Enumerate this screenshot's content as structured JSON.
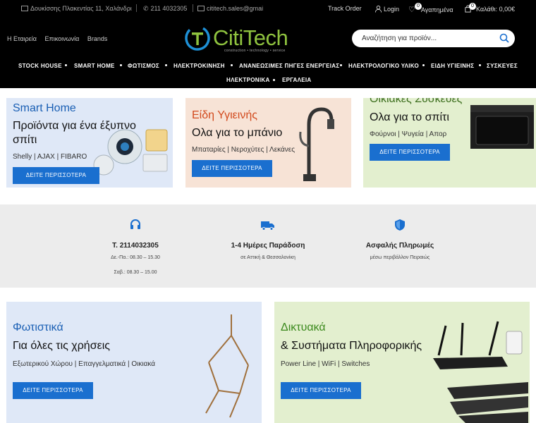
{
  "topbar": {
    "address": "Δουκίσσης Πλακεντίας 11, Χαλάνδρι",
    "phone": "211 4032305",
    "email": "cititech.sales@gmai",
    "track_order": "Track Order",
    "login": "Login",
    "wishlist_count": "0",
    "wishlist_label": "Αγαπημένα",
    "cart_count": "0",
    "cart_label": "Καλάθι: 0,00€"
  },
  "left_links": [
    "Η Εταιρεία",
    "Επικοινωνία",
    "Brands"
  ],
  "logo": {
    "brand": "CitiTech",
    "tagline": "construction • technology • service"
  },
  "search": {
    "placeholder": "Αναζήτηση για προϊόν..."
  },
  "main_nav": [
    "STOCK HOUSE",
    "SMART HOME",
    "ΦΩΤΙΣΜΟΣ",
    "ΗΛΕΚΤΡΟΚΙΝΗΣΗ",
    "ΑΝΑΝΕΩΣΙΜΕΣ ΠΗΓΕΣ ΕΝΕΡΓΕΙΑΣ",
    "ΗΛΕΚΤΡΟΛΟΓΙΚΟ ΥΛΙΚΟ",
    "ΕΙΔΗ ΥΓΙΕΙΝΗΣ",
    "ΣΥΣΚΕΥΕΣ"
  ],
  "secondary_nav": [
    "ΗΛΕΚΤΡΟΝΙΚΑ",
    "ΕΡΓΑΛΕΙΑ"
  ],
  "banners": {
    "smart": {
      "title": "Smart Home",
      "subtitle": "Προϊόντα για ένα έξυπνο σπίτι",
      "sub1": "Προϊόντα για ένα έξυπνο",
      "sub2": "σπίτι",
      "links": "Shelly  |  AJAX  |  FIBARO",
      "button": "ΔΕΙΤΕ ΠΕΡΙΣΣΟΤΕΡΑ"
    },
    "hygiene": {
      "title": "Είδη Υγιεινής",
      "subtitle": "Ολα για το μπάνιο",
      "links": "Μπαταρίες  |  Νεροχύτες  |  Λεκάνες",
      "button": "ΔΕΙΤΕ ΠΕΡΙΣΣΟΤΕΡΑ"
    },
    "appliances": {
      "title": "Οικιακές Συσκευές",
      "subtitle": "Ολα για το σπίτι",
      "links": "Φούρνοι  |  Ψυγεία  |  Απορ",
      "button": "ΔΕΙΤΕ ΠΕΡΙΣΣΟΤΕΡΑ"
    },
    "lighting": {
      "title": "Φωτιστικά",
      "subtitle": "Για όλες τις χρήσεις",
      "links": "Εξωτερικού Χώρου  |  Επαγγελματικά  |  Οικιακά",
      "button": "ΔΕΙΤΕ ΠΕΡΙΣΣΟΤΕΡΑ"
    },
    "network": {
      "title": "Δικτυακά",
      "subtitle": "& Συστήματα Πληροφορικής",
      "links": "Power Line  |  WiFi  |  Switches",
      "button": "ΔΕΙΤΕ ΠΕΡΙΣΣΟΤΕΡΑ"
    }
  },
  "features": [
    {
      "icon": "headset-icon",
      "title": "Τ. 2114032305",
      "line1": "Δε.-Πα.: 08.30 – 15.30",
      "line2": "Σαβ.: 08.30 – 15.00"
    },
    {
      "icon": "truck-icon",
      "title": "1-4 Ημέρες Παράδοση",
      "line1": "σε Αττική & Θεσσαλονίκη"
    },
    {
      "icon": "shield-icon",
      "title": "Ασφαλής Πληρωμές",
      "line1": "μέσω περιβάλλον Πειραιώς"
    }
  ],
  "colors": {
    "accent_blue": "#1a6fcf",
    "logo_green": "#8fc33f",
    "logo_blue": "#1e90d6"
  }
}
